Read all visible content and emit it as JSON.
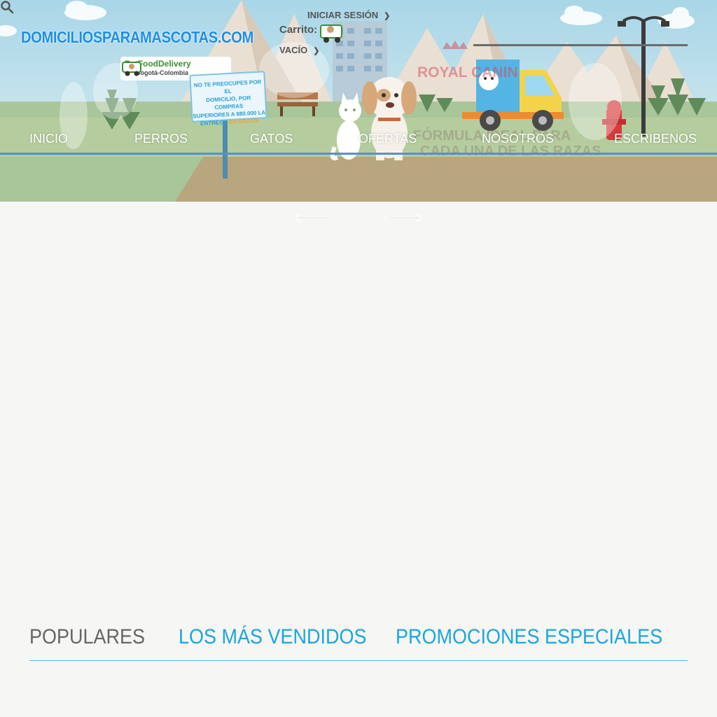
{
  "site": {
    "logo": "DOMICILIOSPARAMASCOTAS.COM",
    "delivery_brand": "PetFoodDelivery",
    "delivery_city": "Bogotá-Colombia"
  },
  "promo_sign": {
    "line1": "NO TE PREOCUPES POR EL",
    "line2": "DOMICILIO, POR COMPRAS",
    "line3": "SUPERIORES A $80.000 LA",
    "line4": "ENTREGA",
    "highlight": "ES GRATIS"
  },
  "header": {
    "login_label": "INICIAR SESIÓN",
    "cart_label": "Carrito:",
    "cart_status": "VACÍO"
  },
  "nav": {
    "items": [
      {
        "label": "INICIO"
      },
      {
        "label": "PERROS"
      },
      {
        "label": "GATOS"
      },
      {
        "label": "OFERTAS"
      },
      {
        "label": "NOSOTROS"
      },
      {
        "label": "ESCRIBENOS"
      }
    ]
  },
  "banner": {
    "brand": "ROYAL CANIN",
    "headline": "FÓRMULA IDEAL PARA CADA UNA DE LAS RAZAS"
  },
  "tabs": [
    {
      "label": "POPULARES",
      "active": true
    },
    {
      "label": "LOS MÁS VENDIDOS",
      "active": false
    },
    {
      "label": "PROMOCIONES ESPECIALES",
      "active": false
    }
  ],
  "colors": {
    "logo": "#1e8fe6",
    "accent": "#27a9e1",
    "menu_line": "#5890c9",
    "tab_inactive": "#1aa7dc",
    "tab_active": "#666666"
  }
}
